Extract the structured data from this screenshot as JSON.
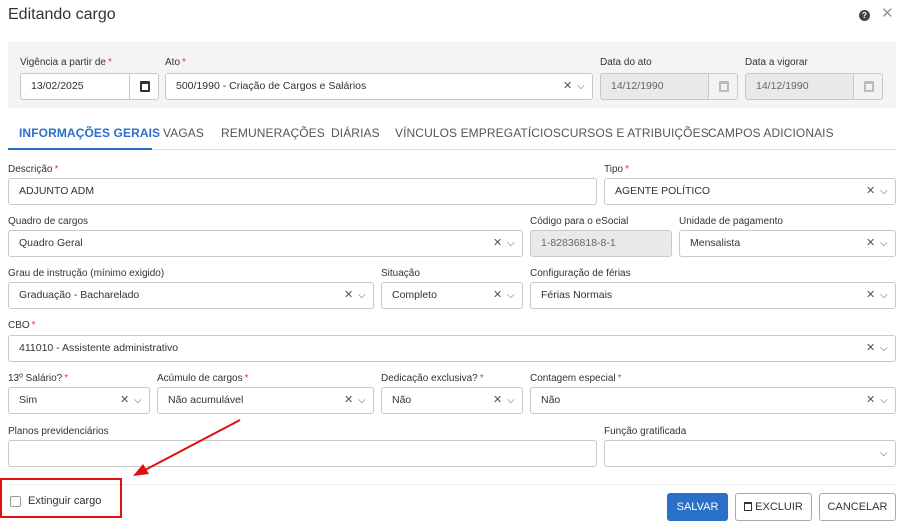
{
  "window": {
    "title": "Editando cargo"
  },
  "header_fields": {
    "vigencia": {
      "label": "Vigência a partir de",
      "value": "13/02/2025"
    },
    "ato": {
      "label": "Ato",
      "value": "500/1990 - Criação de Cargos e Salários"
    },
    "data_ato": {
      "label": "Data do ato",
      "value": "14/12/1990"
    },
    "data_vigorar": {
      "label": "Data a vigorar",
      "value": "14/12/1990"
    }
  },
  "tabs": [
    {
      "label": "INFORMAÇÕES GERAIS",
      "active": true
    },
    {
      "label": "VAGAS"
    },
    {
      "label": "REMUNERAÇÕES"
    },
    {
      "label": "DIÁRIAS"
    },
    {
      "label": "VÍNCULOS EMPREGATÍCIOS"
    },
    {
      "label": "CURSOS E ATRIBUIÇÕES"
    },
    {
      "label": "CAMPOS ADICIONAIS"
    }
  ],
  "form": {
    "descricao": {
      "label": "Descrição",
      "value": "ADJUNTO ADM"
    },
    "tipo": {
      "label": "Tipo",
      "value": "AGENTE POLÍTICO"
    },
    "quadro": {
      "label": "Quadro de cargos",
      "value": "Quadro Geral"
    },
    "codigo_esocial": {
      "label": "Código para o eSocial",
      "value": "1-82836818-8-1"
    },
    "unidade_pagamento": {
      "label": "Unidade de pagamento",
      "value": "Mensalista"
    },
    "grau_instrucao": {
      "label": "Grau de instrução (mínimo exigido)",
      "value": "Graduação - Bacharelado"
    },
    "situacao": {
      "label": "Situação",
      "value": "Completo"
    },
    "config_ferias": {
      "label": "Configuração de férias",
      "value": "Férias Normais"
    },
    "cbo": {
      "label": "CBO",
      "value": "411010 - Assistente administrativo"
    },
    "decimo_terceiro": {
      "label": "13º Salário?",
      "value": "Sim"
    },
    "acumulo": {
      "label": "Acúmulo de cargos",
      "value": "Não acumulável"
    },
    "dedicacao": {
      "label": "Dedicação exclusiva?",
      "value": "Não"
    },
    "contagem": {
      "label": "Contagem especial",
      "value": "Não"
    },
    "planos": {
      "label": "Planos previdenciários",
      "value": ""
    },
    "funcao_gratificada": {
      "label": "Função gratificada",
      "value": ""
    }
  },
  "footer": {
    "extinguir_label": "Extinguir cargo",
    "save_label": "SALVAR",
    "delete_label": "EXCLUIR",
    "cancel_label": "CANCELAR"
  },
  "colors": {
    "primary": "#2a70c8",
    "required": "#e53935",
    "annotation": "#e01010"
  }
}
